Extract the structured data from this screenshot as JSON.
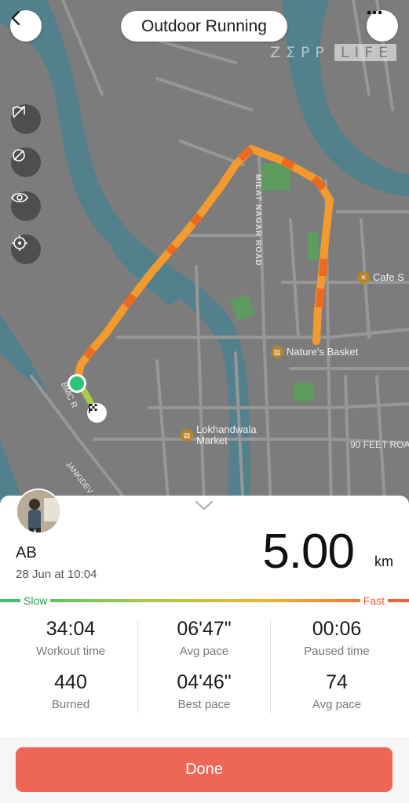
{
  "header": {
    "title": "Outdoor Running",
    "watermark_a": "ZΣPP",
    "watermark_b": "LIFE"
  },
  "map": {
    "labels": {
      "milat_nagar_road": "MILAT NAGAR ROAD",
      "cafe": "Cafe S",
      "natures_basket": "Nature's Basket",
      "lokhandwala_market": "Lokhandwala\nMarket",
      "feet_road": "90 FEET ROA",
      "bmc": "BMC R",
      "jankidevi": "JANKIDEV"
    },
    "icons": {
      "back": "chevron-left-icon",
      "more": "more-horizontal-icon",
      "side": [
        "hide-map-icon",
        "no-location-icon",
        "eye-icon",
        "locate-icon"
      ],
      "start": "start-point-icon",
      "finish": "finish-flag-icon"
    },
    "colors": {
      "route": "#f39a2e",
      "route_fast": "#ec6a1f",
      "water": "#52808c",
      "start": "#2fc27a"
    }
  },
  "workout": {
    "user": "AB",
    "datetime": "28 Jun at 10:04",
    "distance": "5.00",
    "unit": "km",
    "scale_slow": "Slow",
    "scale_fast": "Fast",
    "stats": [
      {
        "value": "34:04",
        "label": "Workout time"
      },
      {
        "value": "06'47\"",
        "label": "Avg pace"
      },
      {
        "value": "00:06",
        "label": "Paused time"
      },
      {
        "value": "440",
        "label": "Burned"
      },
      {
        "value": "04'46\"",
        "label": "Best pace"
      },
      {
        "value": "74",
        "label": "Avg pace"
      }
    ]
  },
  "footer": {
    "done_label": "Done",
    "done_color": "#ee6656"
  }
}
